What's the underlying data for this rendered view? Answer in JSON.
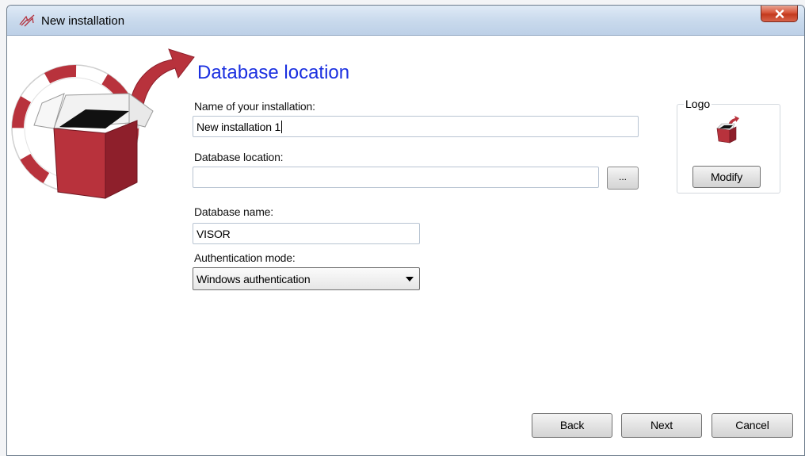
{
  "window": {
    "title": "New installation",
    "close_icon": "close-icon"
  },
  "page": {
    "heading": "Database location"
  },
  "form": {
    "installation_name": {
      "label": "Name of your installation:",
      "value": "New installation 1"
    },
    "database_location": {
      "label": "Database location:",
      "value": "",
      "browse_label": "..."
    },
    "database_name": {
      "label": "Database name:",
      "value": "VISOR"
    },
    "authentication_mode": {
      "label": "Authentication mode:",
      "selected": "Windows authentication"
    }
  },
  "logo": {
    "legend": "Logo",
    "modify_label": "Modify"
  },
  "footer": {
    "back_label": "Back",
    "next_label": "Next",
    "cancel_label": "Cancel"
  },
  "colors": {
    "heading": "#1a2fe0",
    "box_red": "#b8323c",
    "box_dark_red": "#8e1f2b",
    "close_red": "#c8452a"
  }
}
